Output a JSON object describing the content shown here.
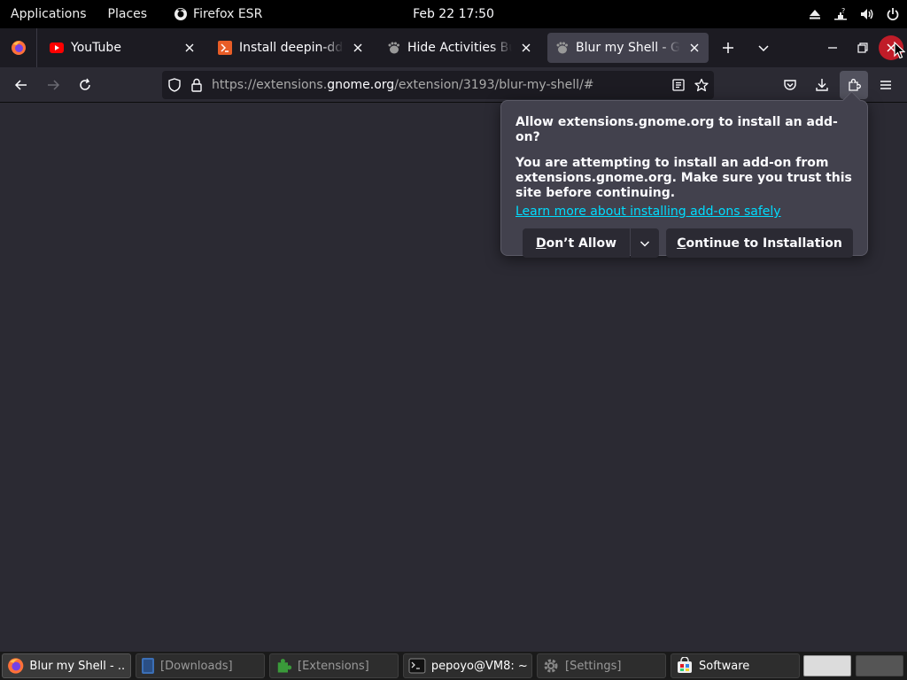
{
  "topbar": {
    "applications": "Applications",
    "places": "Places",
    "app_name": "Firefox ESR",
    "clock": "Feb 22  17:50"
  },
  "tabs": [
    {
      "label": "YouTube",
      "favicon": "youtube-icon",
      "active": false
    },
    {
      "label": "Install deepin-dde on Deb",
      "favicon": "install-icon",
      "active": false
    },
    {
      "label": "Hide Activities Button - GN",
      "favicon": "gnome-foot-icon",
      "active": false
    },
    {
      "label": "Blur my Shell - GNOME Sh",
      "favicon": "gnome-foot-icon",
      "active": true
    }
  ],
  "urlbar": {
    "url_prefix": "https://extensions.",
    "url_domain": "gnome.org",
    "url_suffix": "/extension/3193/blur-my-shell/#"
  },
  "popup": {
    "title": "Allow extensions.gnome.org to install an add-on?",
    "body": "You are attempting to install an add-on from extensions.gnome.org. Make sure you trust this site before continuing.",
    "link": "Learn more about installing add-ons safely",
    "dont_allow_first": "D",
    "dont_allow_rest": "on’t Allow",
    "continue_first": "C",
    "continue_rest": "ontinue to Installation"
  },
  "taskbar": [
    {
      "label": "Blur my Shell - ...",
      "icon": "firefox-icon",
      "state": "active"
    },
    {
      "label": "[Downloads]",
      "icon": "folder-icon",
      "state": "minimized"
    },
    {
      "label": "[Extensions]",
      "icon": "puzzle-icon",
      "state": "minimized"
    },
    {
      "label": "pepoyo@VM8: ~",
      "icon": "terminal-icon",
      "state": "normal"
    },
    {
      "label": "[Settings]",
      "icon": "gear-icon",
      "state": "minimized"
    },
    {
      "label": "Software",
      "icon": "software-icon",
      "state": "normal"
    }
  ],
  "colors": {
    "accent_link": "#00ddff",
    "close_button": "#c01c28",
    "content_bg": "#2b2a33"
  }
}
